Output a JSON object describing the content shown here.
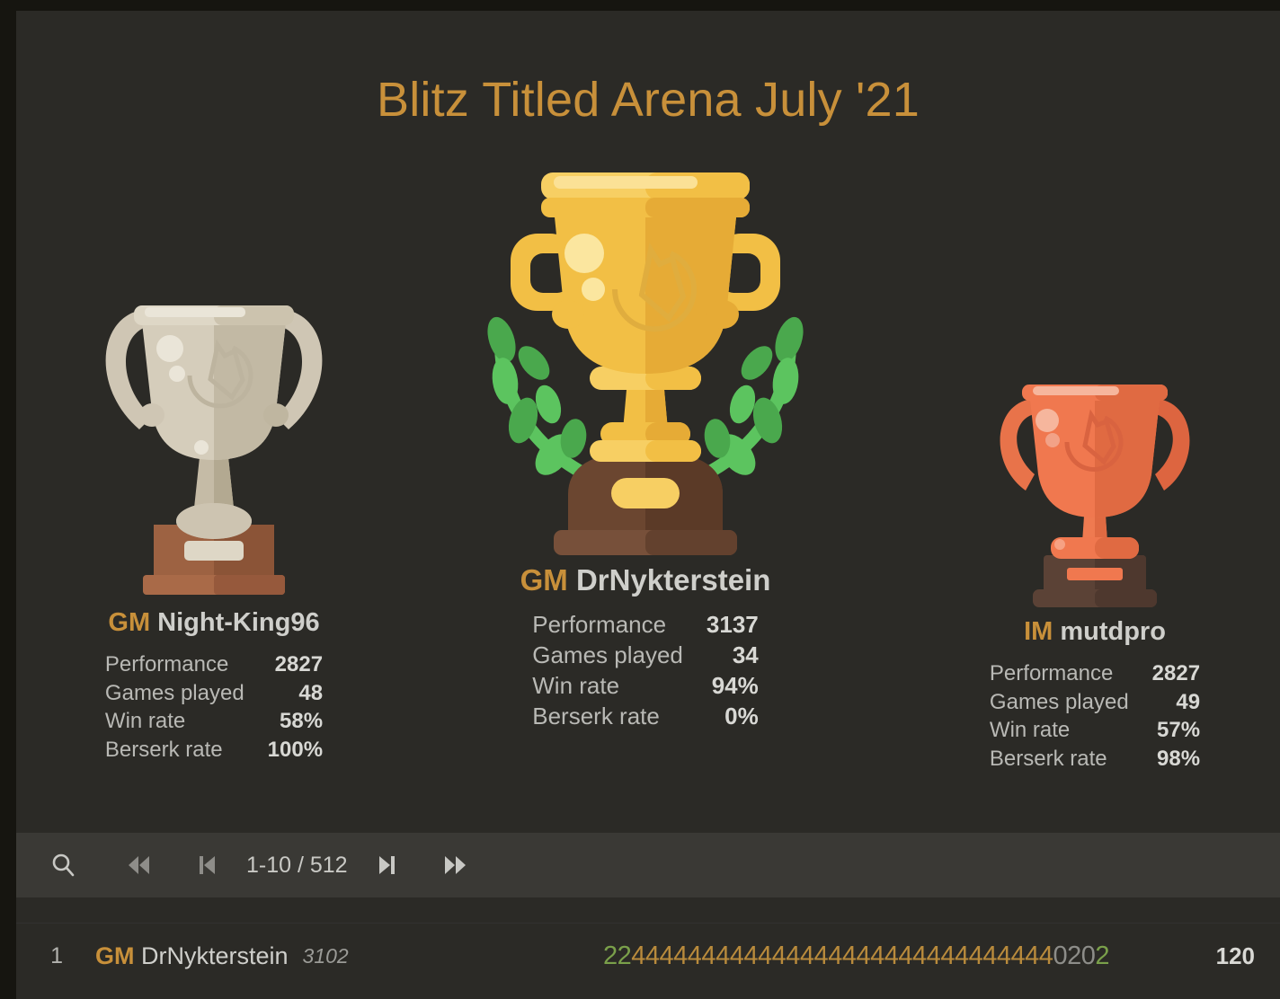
{
  "tournament": {
    "title": "Blitz Titled Arena July '21"
  },
  "podium": [
    {
      "place": 1,
      "title": "GM",
      "username": "DrNykterstein",
      "trophy": "gold-trophy-with-laurel",
      "stats": [
        {
          "label": "Performance",
          "value": "3137"
        },
        {
          "label": "Games played",
          "value": "34"
        },
        {
          "label": "Win rate",
          "value": "94%"
        },
        {
          "label": "Berserk rate",
          "value": "0%"
        }
      ]
    },
    {
      "place": 2,
      "title": "GM",
      "username": "Night-King96",
      "trophy": "silver-trophy",
      "stats": [
        {
          "label": "Performance",
          "value": "2827"
        },
        {
          "label": "Games played",
          "value": "48"
        },
        {
          "label": "Win rate",
          "value": "58%"
        },
        {
          "label": "Berserk rate",
          "value": "100%"
        }
      ]
    },
    {
      "place": 3,
      "title": "IM",
      "username": "mutdpro",
      "trophy": "bronze-trophy",
      "stats": [
        {
          "label": "Performance",
          "value": "2827"
        },
        {
          "label": "Games played",
          "value": "49"
        },
        {
          "label": "Win rate",
          "value": "57%"
        },
        {
          "label": "Berserk rate",
          "value": "98%"
        }
      ]
    }
  ],
  "toolbar": {
    "search_icon": "search-icon",
    "first_page_icon": "first-page-icon",
    "prev_page_icon": "previous-page-icon",
    "next_page_icon": "next-page-icon",
    "last_page_icon": "last-page-icon",
    "page_count": "1-10 / 512"
  },
  "leaderboard": {
    "rows": [
      {
        "rank": "1",
        "title": "GM",
        "username": "DrNykterstein",
        "rating": "3102",
        "total": "120",
        "scores": [
          {
            "value": "2",
            "kind": "win"
          },
          {
            "value": "2",
            "kind": "win"
          },
          {
            "value": "4",
            "kind": "streak"
          },
          {
            "value": "4",
            "kind": "streak"
          },
          {
            "value": "4",
            "kind": "streak"
          },
          {
            "value": "4",
            "kind": "streak"
          },
          {
            "value": "4",
            "kind": "streak"
          },
          {
            "value": "4",
            "kind": "streak"
          },
          {
            "value": "4",
            "kind": "streak"
          },
          {
            "value": "4",
            "kind": "streak"
          },
          {
            "value": "4",
            "kind": "streak"
          },
          {
            "value": "4",
            "kind": "streak"
          },
          {
            "value": "4",
            "kind": "streak"
          },
          {
            "value": "4",
            "kind": "streak"
          },
          {
            "value": "4",
            "kind": "streak"
          },
          {
            "value": "4",
            "kind": "streak"
          },
          {
            "value": "4",
            "kind": "streak"
          },
          {
            "value": "4",
            "kind": "streak"
          },
          {
            "value": "4",
            "kind": "streak"
          },
          {
            "value": "4",
            "kind": "streak"
          },
          {
            "value": "4",
            "kind": "streak"
          },
          {
            "value": "4",
            "kind": "streak"
          },
          {
            "value": "4",
            "kind": "streak"
          },
          {
            "value": "4",
            "kind": "streak"
          },
          {
            "value": "4",
            "kind": "streak"
          },
          {
            "value": "4",
            "kind": "streak"
          },
          {
            "value": "4",
            "kind": "streak"
          },
          {
            "value": "4",
            "kind": "streak"
          },
          {
            "value": "4",
            "kind": "streak"
          },
          {
            "value": "4",
            "kind": "streak"
          },
          {
            "value": "4",
            "kind": "streak"
          },
          {
            "value": "4",
            "kind": "streak"
          },
          {
            "value": "0",
            "kind": "zero"
          },
          {
            "value": "2",
            "kind": "zero"
          },
          {
            "value": "0",
            "kind": "zero"
          },
          {
            "value": "2",
            "kind": "win"
          }
        ]
      }
    ]
  },
  "colors": {
    "accent_gold": "#c8903a",
    "panel_bg": "#2b2a26",
    "toolbar_bg": "#3a3935",
    "win_green": "#7aa04a",
    "streak_gold": "#b98b3c",
    "zero_grey": "#8d8d89"
  }
}
